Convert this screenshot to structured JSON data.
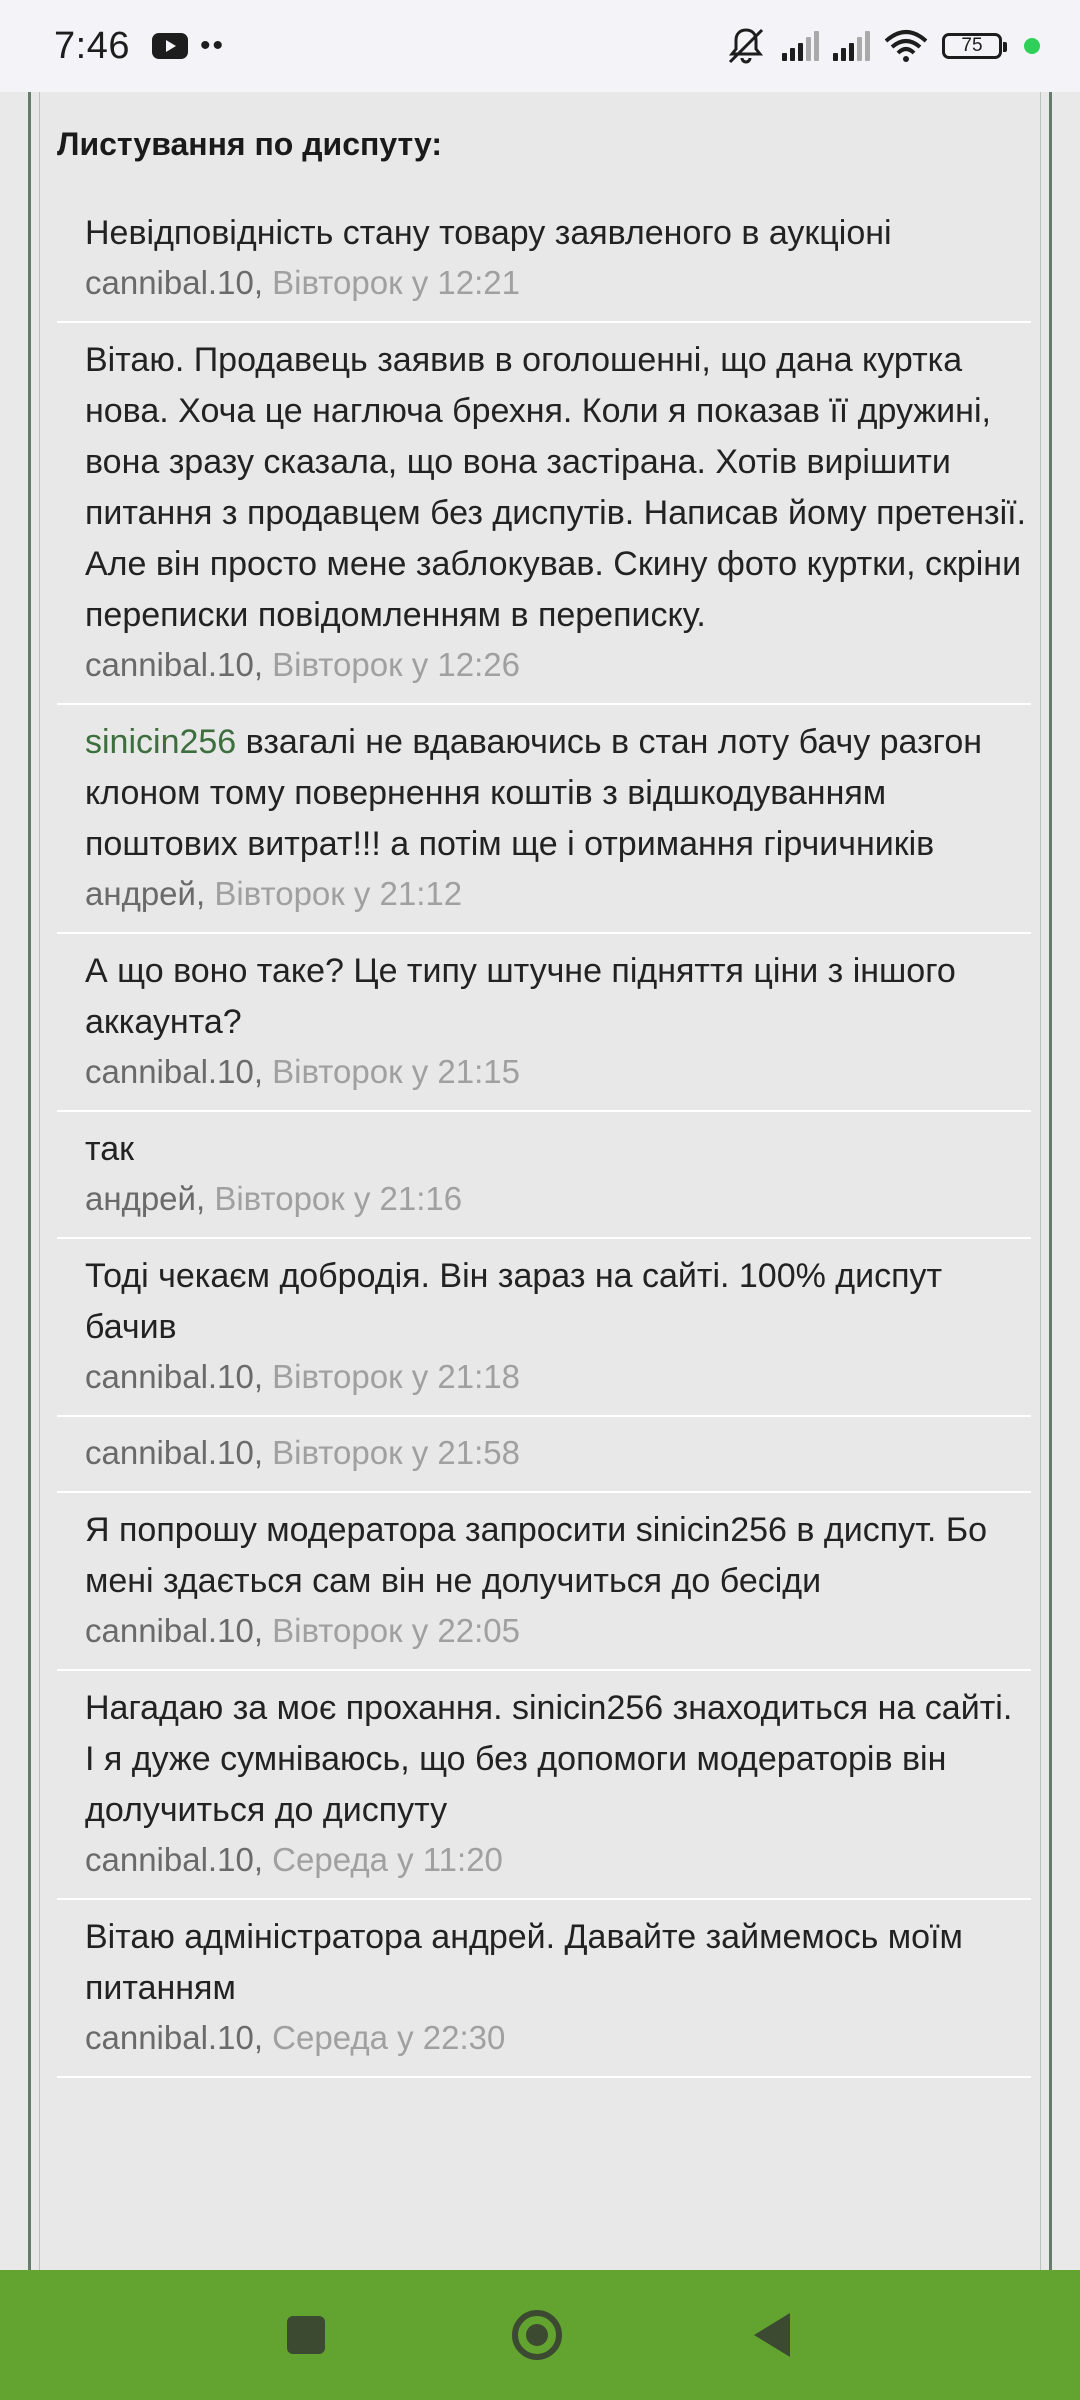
{
  "status_bar": {
    "time": "7:46",
    "dots": "••",
    "battery": "75",
    "icons": [
      "youtube-icon",
      "mute-icon",
      "signal-icon",
      "signal-icon",
      "wifi-icon",
      "battery-icon"
    ],
    "status_dot_color": "#2fd05a"
  },
  "page": {
    "heading": "Листування по диспуту:"
  },
  "messages": [
    {
      "text": "Невідповідність стану товару заявленого в аукціоні",
      "user": "cannibal.10",
      "sep": ", ",
      "date": "Вівторок у 12:21"
    },
    {
      "text": "Вітаю. Продавець заявив в оголошенні, що дана куртка нова. Хоча це наглюча брехня. Коли я показав її дружині, вона зразу сказала, що вона застірана. Хотів вирішити питання з продавцем без диспутів. Написав йому претензії. Але він просто мене заблокував. Скину фото куртки, скріни переписки повідомленням в переписку.",
      "user": "cannibal.10",
      "sep": ", ",
      "date": "Вівторок у 12:26"
    },
    {
      "mention": "sinicin256",
      "text": " взагалі не вдаваючись в стан лоту бачу разгон клоном тому повернення коштів з відшкодуванням поштових витрат!!! а потім ще і отримання гірчичників",
      "user": "андрей",
      "sep": ", ",
      "date": "Вівторок у 21:12"
    },
    {
      "text": "А що воно таке? Це типу штучне підняття ціни з іншого аккаунта?",
      "user": "cannibal.10",
      "sep": ", ",
      "date": "Вівторок у 21:15"
    },
    {
      "text": "так",
      "user": "андрей",
      "sep": ", ",
      "date": "Вівторок у 21:16"
    },
    {
      "text": "Тоді чекаєм добродія. Він зараз на сайті. 100% диспут бачив",
      "user": "cannibal.10",
      "sep": ", ",
      "date": "Вівторок у 21:18"
    },
    {
      "text": "",
      "user": "cannibal.10",
      "sep": ", ",
      "date": "Вівторок у 21:58"
    },
    {
      "text": "Я попрошу модератора запросити sinicin256 в диспут. Бо мені здається сам він не долучиться до бесіди",
      "user": "cannibal.10",
      "sep": ", ",
      "date": "Вівторок у 22:05"
    },
    {
      "text": "Нагадаю за моє прохання. sinicin256 знаходиться на сайті. І я дуже сумніваюсь, що без допомоги модераторів він долучиться до диспуту",
      "user": "cannibal.10",
      "sep": ", ",
      "date": "Середа у 11:20"
    },
    {
      "text": "Вітаю адміністратора андрей. Давайте займемось моїм питанням",
      "user": "cannibal.10",
      "sep": ", ",
      "date": "Середа у 22:30"
    }
  ],
  "nav": {
    "color": "#63a430",
    "buttons": [
      "recents-button",
      "home-button",
      "back-button"
    ]
  }
}
